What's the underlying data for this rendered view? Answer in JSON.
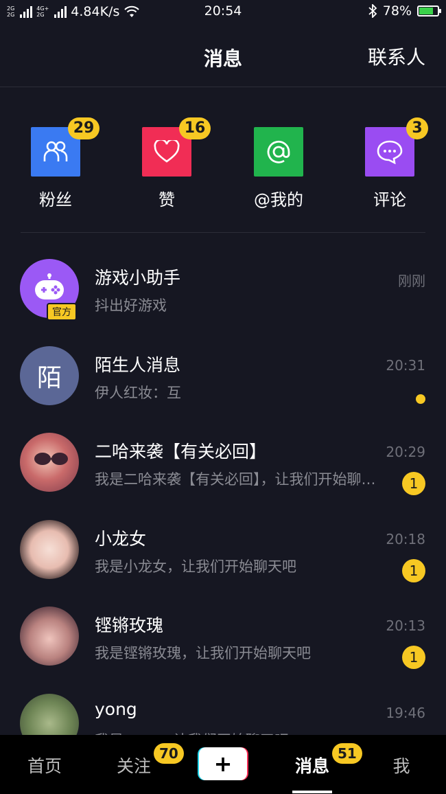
{
  "status_bar": {
    "network_label": "2G 4G+ 2G",
    "speed": "4.84K/s",
    "time": "20:54",
    "battery_percent": "78%",
    "battery_level": 0.78
  },
  "header": {
    "title": "消息",
    "contacts": "联系人"
  },
  "quick_actions": [
    {
      "label": "粉丝",
      "badge": "29",
      "icon": "fans-icon",
      "color": "#3a7af2"
    },
    {
      "label": "赞",
      "badge": "16",
      "icon": "heart-icon",
      "color": "#f12d55"
    },
    {
      "label": "@我的",
      "badge": "",
      "icon": "at-icon",
      "color": "#21b44d"
    },
    {
      "label": "评论",
      "badge": "3",
      "icon": "comment-icon",
      "color": "#9a4cf2"
    }
  ],
  "conversations": [
    {
      "name": "游戏小助手",
      "preview": "抖出好游戏",
      "time": "刚刚",
      "unread": "",
      "official_tag": "官方",
      "avatar": "gamepad-icon",
      "avatar_color": "#9b59f5"
    },
    {
      "name": "陌生人消息",
      "preview": "伊人红妆：互",
      "time": "20:31",
      "unread": "",
      "avatar_text": "陌",
      "avatar_color": "#5b6796"
    },
    {
      "name": "二哈来袭【有关必回】",
      "preview": "我是二哈来袭【有关必回】，让我们开始聊天吧",
      "time": "20:29",
      "unread": "1"
    },
    {
      "name": "小龙女",
      "preview": "我是小龙女，让我们开始聊天吧",
      "time": "20:18",
      "unread": "1"
    },
    {
      "name": "铿锵玫瑰",
      "preview": "我是铿锵玫瑰，让我们开始聊天吧",
      "time": "20:13",
      "unread": "1"
    },
    {
      "name": "yong",
      "preview": "我是yong，让我们开始聊天吧",
      "time": "19:46",
      "unread": ""
    }
  ],
  "bottom_nav": {
    "home": "首页",
    "follow": "关注",
    "follow_badge": "70",
    "create": "+",
    "messages": "消息",
    "messages_badge": "51",
    "me": "我"
  }
}
